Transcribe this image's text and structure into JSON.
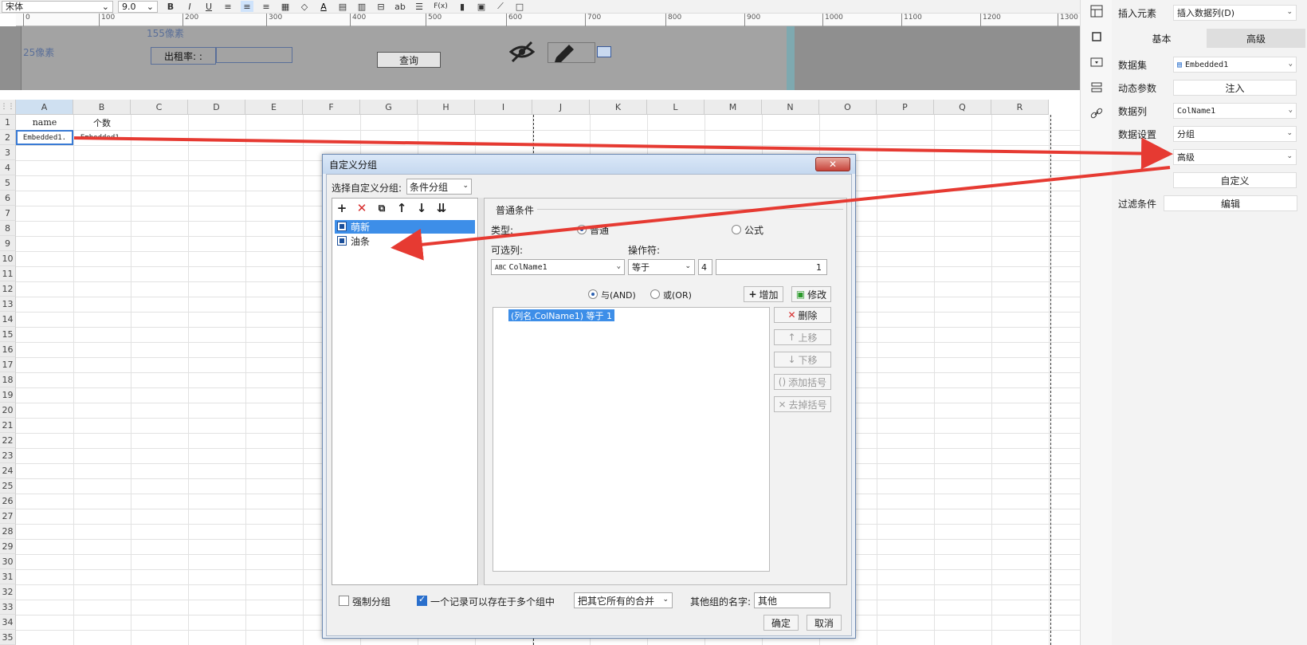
{
  "toolbar": {
    "font_name": "宋体",
    "font_size": "9.0",
    "bold": "B",
    "italic": "I",
    "underline": "U",
    "text_color_glyph": "A",
    "wrap_glyph": "ab",
    "formula_glyph": "F(x)"
  },
  "ruler": {
    "ticks": [
      "0",
      "100",
      "200",
      "300",
      "400",
      "500",
      "600",
      "700",
      "800",
      "900",
      "1000",
      "1100",
      "1200",
      "1300"
    ]
  },
  "form": {
    "px_top": "155像素",
    "px_left": "25像素",
    "label_text": "出租率: :",
    "query_button": "查询"
  },
  "sheet": {
    "columns": [
      "A",
      "B",
      "C",
      "D",
      "E",
      "F",
      "G",
      "H",
      "I",
      "J",
      "K",
      "L",
      "M",
      "N",
      "O",
      "P",
      "Q",
      "R"
    ],
    "rows": [
      "1",
      "2",
      "3",
      "4",
      "5",
      "6",
      "7",
      "8",
      "9",
      "10",
      "11",
      "12",
      "13",
      "14",
      "15",
      "16",
      "17",
      "18",
      "19",
      "20",
      "21",
      "22",
      "23",
      "24",
      "25",
      "26",
      "27",
      "28",
      "29",
      "30",
      "31",
      "32",
      "33",
      "34",
      "35"
    ],
    "a1": "name",
    "b1": "个数",
    "a2": "Embedded1.",
    "b2": "Embedded1."
  },
  "panel": {
    "insert_label": "插入元素",
    "insert_value": "插入数据列(D)",
    "tab_basic": "基本",
    "tab_advanced": "高级",
    "dataset_label": "数据集",
    "dataset_value": "Embedded1",
    "dynamic_label": "动态参数",
    "dynamic_button": "注入",
    "column_label": "数据列",
    "column_value": "ColName1",
    "setting_label": "数据设置",
    "setting_value": "分组",
    "advanced_value": "高级",
    "custom_button": "自定义",
    "filter_label": "过滤条件",
    "filter_button": "编辑"
  },
  "dialog": {
    "title": "自定义分组",
    "close": "✕",
    "select_label": "选择自定义分组:",
    "select_value": "条件分组",
    "groups": [
      "萌新",
      "油条"
    ],
    "section_title": "普通条件",
    "type_label": "类型:",
    "type_normal": "普通",
    "type_formula": "公式",
    "col_label": "可选列:",
    "op_label": "操作符:",
    "col_value": "ColName1",
    "op_value": "等于",
    "value_input": "1",
    "and_label": "与(AND)",
    "or_label": "或(OR)",
    "add_button": "增加",
    "modify_button": "修改",
    "condition": "(列名.ColName1) 等于 1",
    "delete_button": "删除",
    "up_button": "上移",
    "down_button": "下移",
    "add_paren_button": "添加括号",
    "remove_paren_button": "去掉括号",
    "force_group": "强制分组",
    "multi_group": "一个记录可以存在于多个组中",
    "merge_option": "把其它所有的合并",
    "other_name_label": "其他组的名字:",
    "other_name_value": "其他",
    "ok_button": "确定",
    "cancel_button": "取消"
  }
}
